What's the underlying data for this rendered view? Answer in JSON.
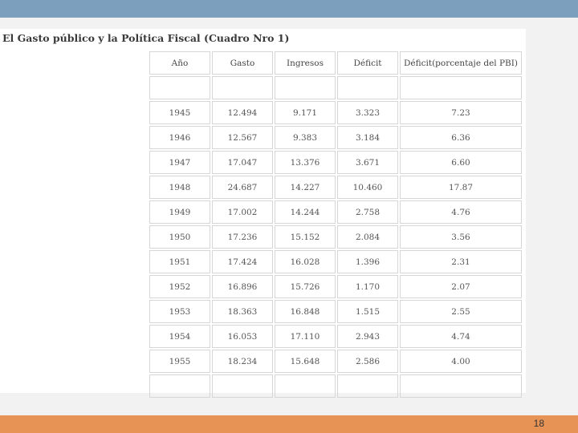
{
  "document": {
    "title": "El Gasto público y la Política Fiscal (Cuadro Nro 1)"
  },
  "table": {
    "headers": [
      "Año",
      "Gasto",
      "Ingresos",
      "Déficit",
      "Déficit(porcentaje del PBI)"
    ],
    "rows": [
      [
        "1945",
        "12.494",
        "9.171",
        "3.323",
        "7.23"
      ],
      [
        "1946",
        "12.567",
        "9.383",
        "3.184",
        "6.36"
      ],
      [
        "1947",
        "17.047",
        "13.376",
        "3.671",
        "6.60"
      ],
      [
        "1948",
        "24.687",
        "14.227",
        "10.460",
        "17.87"
      ],
      [
        "1949",
        "17.002",
        "14.244",
        "2.758",
        "4.76"
      ],
      [
        "1950",
        "17.236",
        "15.152",
        "2.084",
        "3.56"
      ],
      [
        "1951",
        "17.424",
        "16.028",
        "1.396",
        "2.31"
      ],
      [
        "1952",
        "16.896",
        "15.726",
        "1.170",
        "2.07"
      ],
      [
        "1953",
        "18.363",
        "16.848",
        "1.515",
        "2.55"
      ],
      [
        "1954",
        "16.053",
        "17.110",
        "2.943",
        "4.74"
      ],
      [
        "1955",
        "18.234",
        "15.648",
        "2.586",
        "4.00"
      ]
    ]
  },
  "footer": {
    "page_number": "18"
  }
}
